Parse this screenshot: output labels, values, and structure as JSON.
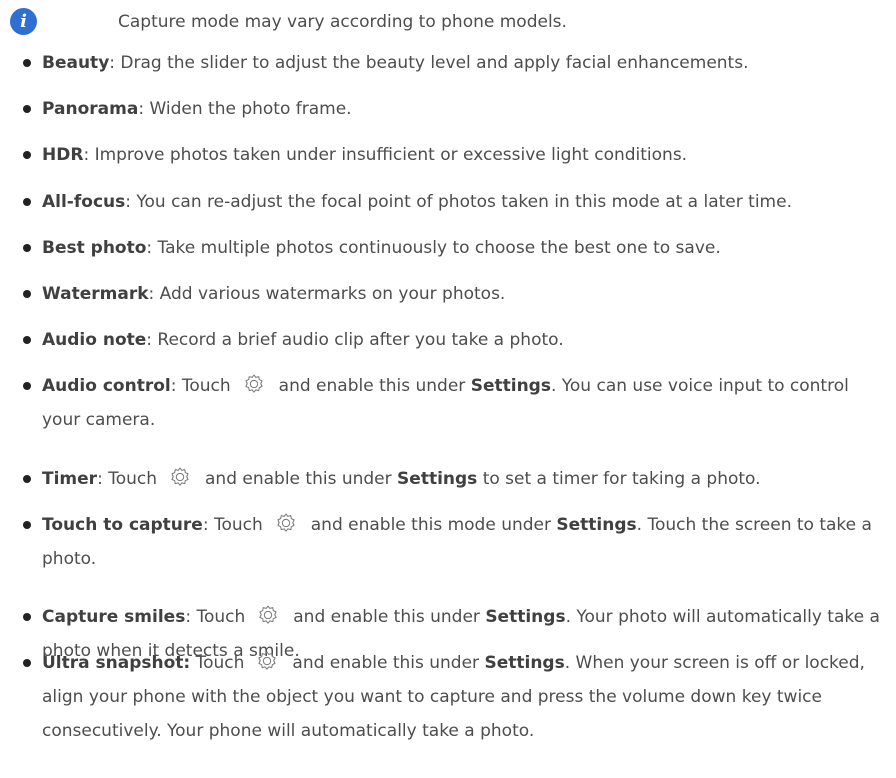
{
  "note": {
    "icon": "info-icon",
    "icon_glyph": "i",
    "text": "Capture mode may vary according to phone models."
  },
  "accent_color": "#2e6fd1",
  "modes": [
    {
      "term": "Beauty",
      "desc": ": Drag the slider to adjust the beauty level and apply facial enhancements."
    },
    {
      "term": "Panorama",
      "desc": ": Widen the photo frame."
    },
    {
      "term": "HDR",
      "desc": ": Improve photos taken under insufficient or excessive light conditions."
    },
    {
      "term": "All-focus",
      "desc": ": You can re-adjust the focal point of photos taken in this mode at a later time."
    },
    {
      "term": "Best photo",
      "desc": ": Take multiple photos continuously to choose the best one to save."
    },
    {
      "term": "Watermark",
      "desc": ": Add various watermarks on your photos."
    },
    {
      "term": "Audio note",
      "desc": ": Record a brief audio clip after you take a photo."
    },
    {
      "term": "Audio control",
      "pre": ": Touch",
      "post": "and enable this under",
      "kw": "Settings",
      "tail": ". You can use voice input to control your camera."
    },
    {
      "term": "Timer",
      "pre": ": Touch",
      "post": "and enable this under",
      "kw": "Settings",
      "tail": " to set a timer for taking a photo."
    },
    {
      "term": "Touch to capture",
      "pre": ": Touch",
      "post": "and enable this mode under",
      "kw": "Settings",
      "tail": ". Touch the screen to take a photo."
    },
    {
      "term": "Capture smiles",
      "pre": ": Touch",
      "post": "and enable this under",
      "kw": "Settings",
      "tail": ". Your photo will automatically take a photo when it detects a smile."
    },
    {
      "term": "Ultra snapshot:",
      "pre": " Touch",
      "post": "and enable this under",
      "kw": "Settings",
      "tail": ". When your screen is off or locked, align your phone with the object you want to capture and press the volume down key twice consecutively. Your phone will automatically take a photo."
    }
  ],
  "gear_icon": "gear-icon"
}
